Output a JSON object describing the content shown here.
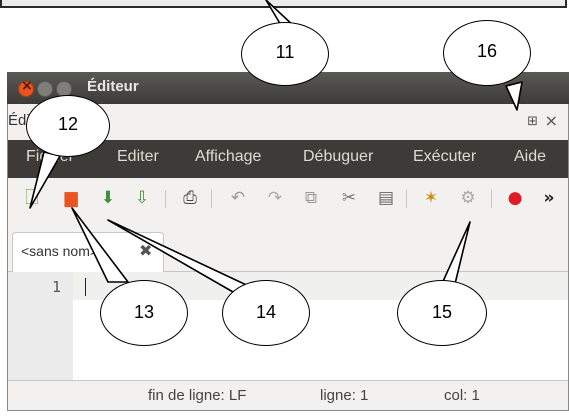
{
  "window": {
    "title": "Éditeur",
    "panel_title": "Éditeur"
  },
  "menubar": {
    "items": [
      "Fichier",
      "Editer",
      "Affichage",
      "Débuguer",
      "Exécuter",
      "Aide"
    ]
  },
  "toolbar": {
    "icons": [
      "new-file-icon",
      "open-file-icon",
      "save-icon",
      "save-as-icon",
      "print-icon",
      "undo-icon",
      "redo-icon",
      "copy-icon",
      "cut-icon",
      "paste-icon",
      "debug-icon",
      "run-icon",
      "record-icon"
    ],
    "overflow": "»"
  },
  "tab": {
    "label": "<sans nom>"
  },
  "editor": {
    "line_number": "1"
  },
  "status": {
    "eol": "fin de ligne: LF",
    "line": "ligne: 1",
    "col": "col: 1"
  },
  "callouts": {
    "c11": "11",
    "c12": "12",
    "c13": "13",
    "c14": "14",
    "c15": "15",
    "c16": "16"
  },
  "colors": {
    "titlebar": "#3c3b37",
    "close_button": "#e95420",
    "record": "#e01b24"
  }
}
